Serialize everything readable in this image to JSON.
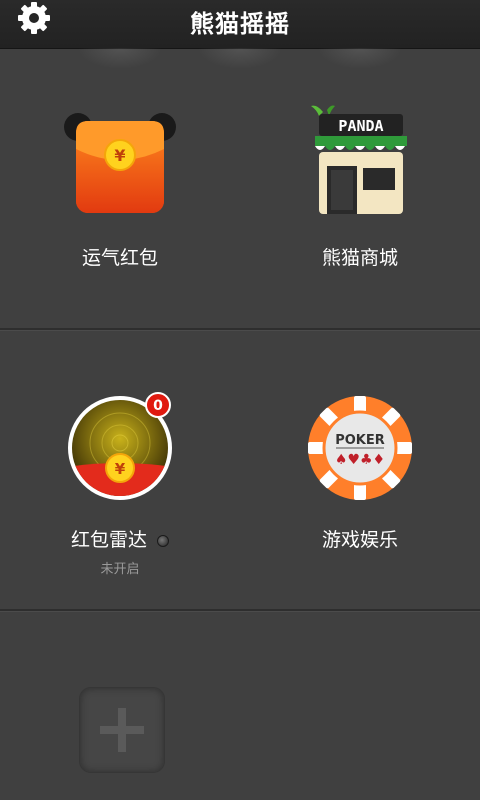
{
  "header": {
    "title": "熊猫摇摇",
    "settings_icon": "gear-icon"
  },
  "grid": {
    "red_packet": {
      "label": "运气红包",
      "icon": "red-envelope-icon",
      "symbol": "¥"
    },
    "panda_store": {
      "label": "熊猫商城",
      "icon": "store-icon",
      "sign": "PANDA"
    },
    "radar": {
      "label": "红包雷达",
      "status": "未开启",
      "badge_count": "0",
      "icon": "radar-icon",
      "symbol": "¥"
    },
    "games": {
      "label": "游戏娱乐",
      "icon": "poker-chip-icon",
      "chip_text": "POKER",
      "suits": "♠♥♣♦"
    },
    "add": {
      "icon": "plus-icon"
    }
  },
  "colors": {
    "background": "#404040",
    "header": "#252525",
    "accent_orange": "#ff7f2a",
    "red": "#e32b1c",
    "yellow": "#ffd200"
  }
}
